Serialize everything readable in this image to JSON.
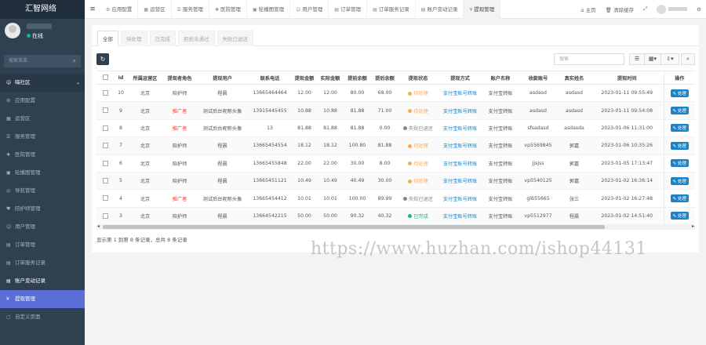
{
  "brand": "汇智网络",
  "user": {
    "status": "在线"
  },
  "sidebar": {
    "search_placeholder": "搜索菜单",
    "items": [
      {
        "label": "嗨社区",
        "icon": "user-icon",
        "type": "parent"
      },
      {
        "label": "应用配置",
        "icon": "gear-icon"
      },
      {
        "label": "运营区",
        "icon": "grid-icon"
      },
      {
        "label": "服务管理",
        "icon": "list-icon"
      },
      {
        "label": "医院管理",
        "icon": "hospital-icon"
      },
      {
        "label": "轮播图管理",
        "icon": "image-icon"
      },
      {
        "label": "导航管理",
        "icon": "compass-icon"
      },
      {
        "label": "陪护师管理",
        "icon": "nurse-icon"
      },
      {
        "label": "用户管理",
        "icon": "user-icon"
      },
      {
        "label": "订单管理",
        "icon": "order-icon"
      },
      {
        "label": "订单服务记录",
        "icon": "record-icon"
      },
      {
        "label": "账户变动记录",
        "icon": "record-icon",
        "type": "bold"
      },
      {
        "label": "提现管理",
        "icon": "withdraw-icon",
        "type": "active"
      },
      {
        "label": "自定义页面",
        "icon": "page-icon"
      }
    ]
  },
  "topbar": {
    "tabs": [
      {
        "label": "应用配置",
        "icon": "gear-icon"
      },
      {
        "label": "运营区",
        "icon": "grid-icon"
      },
      {
        "label": "服务管理",
        "icon": "list-icon"
      },
      {
        "label": "医院管理",
        "icon": "hospital-icon"
      },
      {
        "label": "轮播图管理",
        "icon": "image-icon"
      },
      {
        "label": "用户管理",
        "icon": "user-icon"
      },
      {
        "label": "订单管理",
        "icon": "order-icon"
      },
      {
        "label": "订单服务记录",
        "icon": "record-icon"
      },
      {
        "label": "账户变动记录",
        "icon": "record-icon"
      },
      {
        "label": "提现管理",
        "icon": "withdraw-icon",
        "active": true
      }
    ],
    "home": "主页",
    "clear_cache": "清除缓存"
  },
  "status_tabs": [
    "全部",
    "待处理",
    "已完成",
    "拒绝未通过",
    "失败已退还"
  ],
  "table_search_placeholder": "搜索",
  "table": {
    "columns": [
      "Id",
      "所属运营区",
      "提现者角色",
      "提现用户",
      "联系电话",
      "提现金额",
      "实际金额",
      "提前余额",
      "提后余额",
      "提现状态",
      "提现方式",
      "账户名称",
      "收款账号",
      "真实姓名",
      "提现时间",
      "操作"
    ],
    "rows": [
      [
        "10",
        "北京",
        "陪护师",
        "程晨",
        "13665464464",
        "12.00",
        "12.00",
        "80.00",
        "68.00",
        "待处理",
        "支付宝账号转账",
        "支付宝转账",
        "asdasd",
        "asdasd",
        "2023-01-11 09:55:49",
        "处理"
      ],
      [
        "9",
        "北京",
        "推广者",
        "测试后台昵称头像",
        "13915445455",
        "10.88",
        "10.88",
        "81.88",
        "71.00",
        "待处理",
        "支付宝账号转账",
        "支付宝转账",
        "asdasd",
        "asdasd",
        "2023-01-11 09:54:08",
        "处理"
      ],
      [
        "8",
        "北京",
        "推广者",
        "测试后台昵称头像",
        "13",
        "81.88",
        "81.88",
        "81.88",
        "0.00",
        "失败已退还",
        "支付宝账号转账",
        "支付宝转账",
        "sfsadasd",
        "asdasda",
        "2023-01-06 11:31:00",
        "处理"
      ],
      [
        "7",
        "北京",
        "陪护师",
        "程晨",
        "13665454554",
        "18.12",
        "18.12",
        "100.80",
        "81.88",
        "待处理",
        "支付宝账号转账",
        "支付宝转账",
        "vp5569845",
        "郭嘉",
        "2023-01-06 10:35:26",
        "处理"
      ],
      [
        "6",
        "北京",
        "陪护师",
        "程晨",
        "13665455848",
        "22.00",
        "22.00",
        "30.00",
        "8.00",
        "待处理",
        "支付宝账号转账",
        "支付宝转账",
        "Jjsjss",
        "郭嘉",
        "2023-01-05 17:13:47",
        "处理"
      ],
      [
        "5",
        "北京",
        "陪护师",
        "程晨",
        "13665451121",
        "10.49",
        "10.49",
        "40.49",
        "30.00",
        "待处理",
        "支付宝账号转账",
        "支付宝转账",
        "vp5540125",
        "郭嘉",
        "2023-01-02 16:36:14",
        "处理"
      ],
      [
        "4",
        "北京",
        "推广者",
        "测试后台昵称头像",
        "13665454412",
        "10.01",
        "10.01",
        "100.00",
        "89.99",
        "失败已退还",
        "支付宝账号转账",
        "支付宝转账",
        "gl655665",
        "张三",
        "2023-01-02 16:27:48",
        "处理"
      ],
      [
        "3",
        "北京",
        "陪护师",
        "程晨",
        "13664542215",
        "50.00",
        "50.00",
        "90.32",
        "40.32",
        "已完成",
        "支付宝账号转账",
        "支付宝转账",
        "vp5512977",
        "程晨",
        "2023-01-02 14:51:40",
        "处理"
      ]
    ]
  },
  "footer": "显示第 1 到第 8 条记录，总共 8 条记录",
  "watermark": "https://www.huzhan.com/ishop44131",
  "colors": {
    "pending": "#f8ac59",
    "failed": "#888888",
    "done": "#1ab394",
    "role_promoter": "#e8412f",
    "accent": "#1c84c6",
    "sidebar": "#2f4050",
    "active_nav": "#5b6ed7"
  }
}
